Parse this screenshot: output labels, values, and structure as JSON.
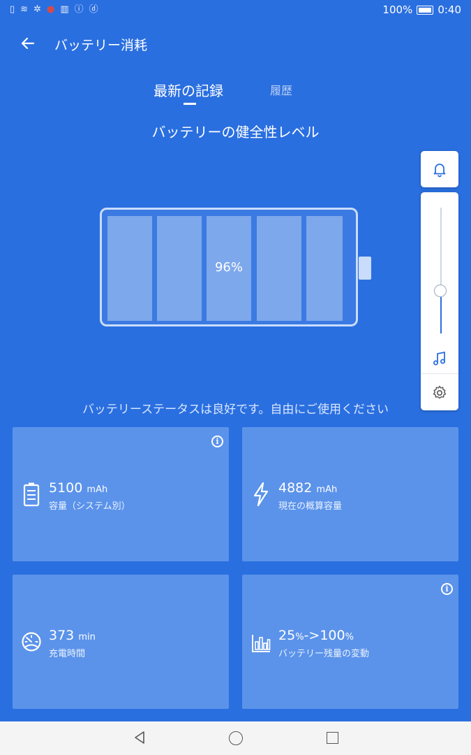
{
  "status_bar": {
    "battery": "100%",
    "time": "0:40"
  },
  "header": {
    "title": "バッテリー消耗"
  },
  "tabs": [
    {
      "label": "最新の記録",
      "active": true
    },
    {
      "label": "履歴",
      "active": false
    }
  ],
  "health": {
    "title": "バッテリーの健全性レベル",
    "percent_label": "96%",
    "level": 0.96,
    "status_text": "バッテリーステータスは良好です。自由にご使用ください"
  },
  "cards": [
    {
      "value": "5100",
      "unit": "mAh",
      "label": "容量（システム別）",
      "icon": "battery-list-icon",
      "info": true
    },
    {
      "value": "4882",
      "unit": "mAh",
      "label": "現在の概算容量",
      "icon": "lightning-icon",
      "info": false
    },
    {
      "value": "373",
      "unit": "min",
      "label": "充電時間",
      "icon": "speedometer-icon",
      "info": false
    },
    {
      "value_a": "25",
      "unit_a": "%",
      "arrow": "->",
      "value_b": "100",
      "unit_b": "%",
      "label": "バッテリー残量の変動",
      "icon": "bar-chart-icon",
      "info": true
    }
  ],
  "colors": {
    "background": "#2a6fe0",
    "card": "#5b93ea",
    "accent": "#2a6fe0"
  }
}
